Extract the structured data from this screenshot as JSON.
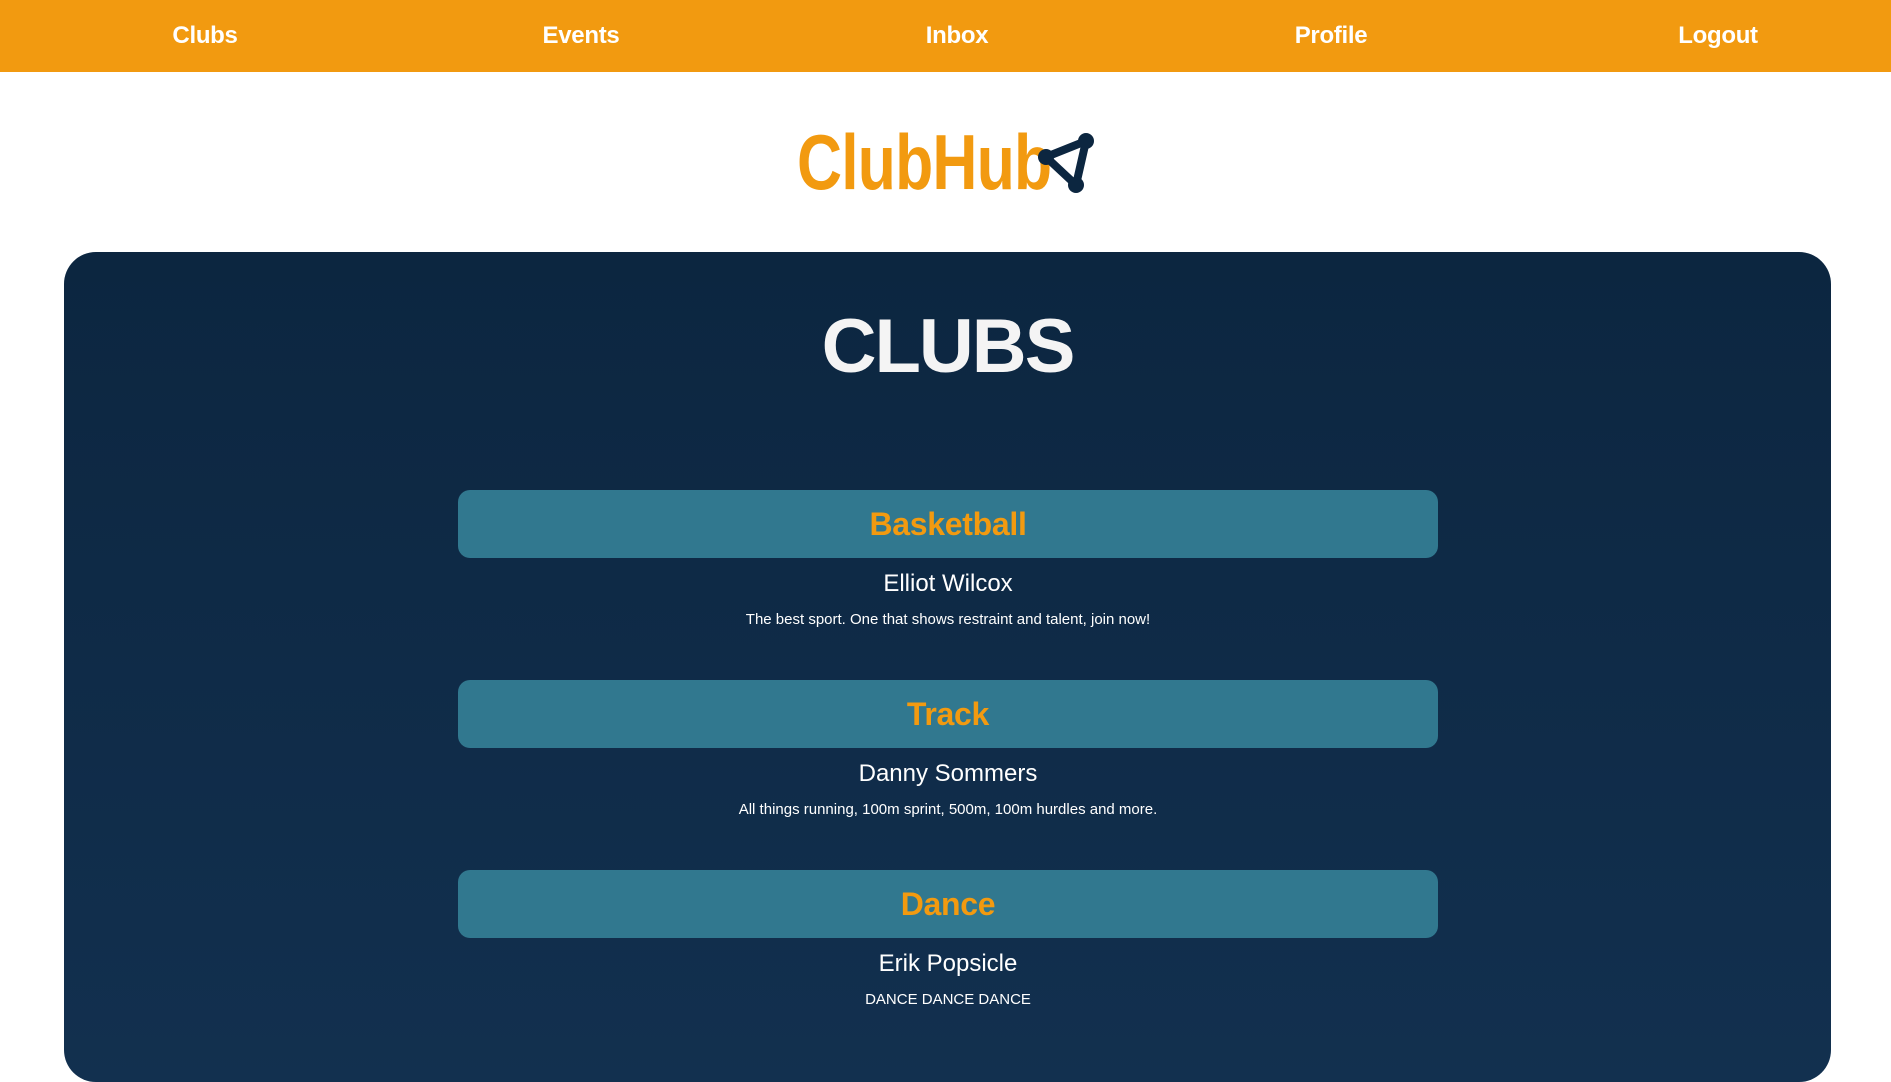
{
  "nav": {
    "items": [
      {
        "label": "Clubs"
      },
      {
        "label": "Events"
      },
      {
        "label": "Inbox"
      },
      {
        "label": "Profile"
      },
      {
        "label": "Logout"
      }
    ]
  },
  "brand": {
    "title": "ClubHub",
    "icon": "nodes-triangle-icon"
  },
  "page": {
    "title": "CLUBS"
  },
  "clubs": [
    {
      "name": "Basketball",
      "leader": "Elliot Wilcox",
      "description": "The best sport. One that shows restraint and talent, join now!"
    },
    {
      "name": "Track",
      "leader": "Danny Sommers",
      "description": "All things running, 100m sprint, 500m, 100m hurdles and more."
    },
    {
      "name": "Dance",
      "leader": "Erik Popsicle",
      "description": "DANCE DANCE DANCE"
    }
  ],
  "colors": {
    "accent": "#f29a10",
    "panel": "#0c2640",
    "club_header": "#31788f",
    "text": "#ffffff"
  }
}
